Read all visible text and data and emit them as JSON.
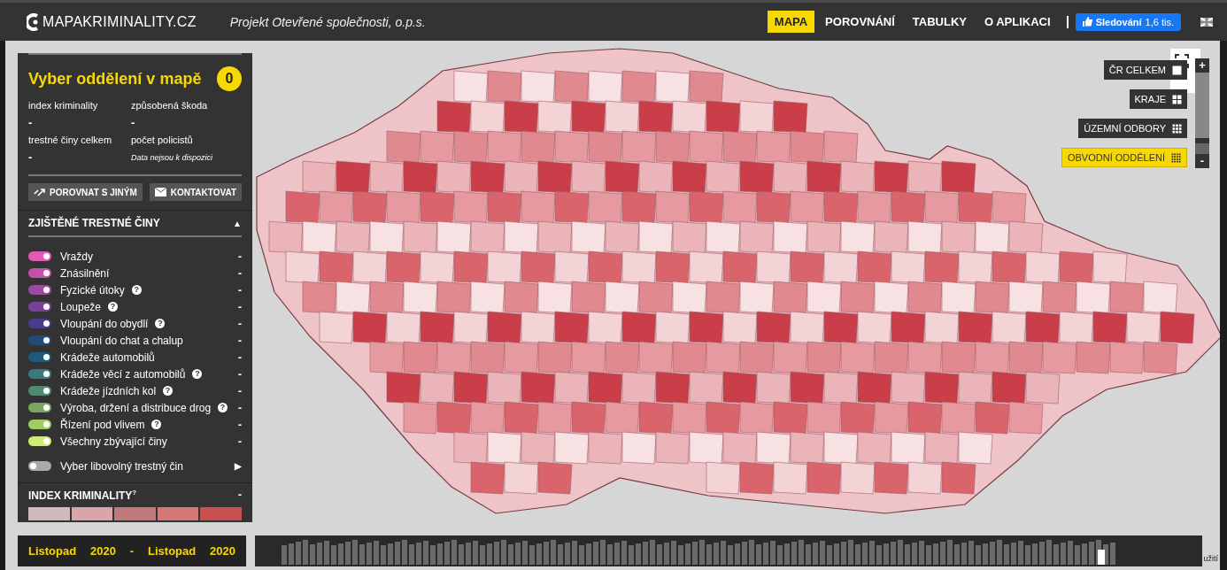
{
  "header": {
    "logo": "MAPAKRIMINALITY.CZ",
    "subtitle": "Projekt Otevřené společnosti, o.p.s.",
    "nav": [
      {
        "label": "MAPA",
        "selected": true
      },
      {
        "label": "POROVNÁNÍ",
        "selected": false
      },
      {
        "label": "TABULKY",
        "selected": false
      },
      {
        "label": "O APLIKACI",
        "selected": false
      }
    ],
    "follow_button": {
      "label": "Sledování",
      "count": "1,6 tis."
    }
  },
  "panel": {
    "title": "Vyber oddělení v mapě",
    "count": "0",
    "stats": [
      {
        "label": "index kriminality",
        "value": "-",
        "kind": "value"
      },
      {
        "label": "způsobená škoda",
        "value": "-",
        "kind": "value"
      },
      {
        "label": "trestné činy celkem",
        "value": "-",
        "kind": "value"
      },
      {
        "label": "počet policistů",
        "value": "Data nejsou k dispozici",
        "kind": "note"
      }
    ],
    "buttons": [
      {
        "label": "POROVNAT S JINÝM"
      },
      {
        "label": "KONTAKTOVAT"
      }
    ],
    "section": {
      "title": "ZJIŠTĚNÉ TRESTNÉ ČINY",
      "arrow": "▲"
    },
    "crimes": [
      {
        "label": "Vraždy",
        "color": "#e05bb5",
        "on": true,
        "value": "-"
      },
      {
        "label": "Znásilnění",
        "color": "#c451a8",
        "on": true,
        "value": "-"
      },
      {
        "label": "Fyzické útoky",
        "color": "#9c4aa0",
        "on": true,
        "help": "?",
        "value": "-"
      },
      {
        "label": "Loupeže",
        "color": "#7b3f9a",
        "on": true,
        "help": "?",
        "value": "-"
      },
      {
        "label": "Vloupání do obydlí",
        "color": "#4a3c8c",
        "on": true,
        "help": "?",
        "value": "-"
      },
      {
        "label": "Vloupání do chat a chalup",
        "color": "#1f4a7a",
        "on": true,
        "value": "-"
      },
      {
        "label": "Krádeže automobilů",
        "color": "#1f5a7a",
        "on": true,
        "value": "-"
      },
      {
        "label": "Krádeže věcí z automobilů",
        "color": "#3a7a7a",
        "on": true,
        "help": "?",
        "value": "-"
      },
      {
        "label": "Krádeže jízdních kol",
        "color": "#4f8a70",
        "on": true,
        "help": "?",
        "value": "-"
      },
      {
        "label": "Výroba, držení a distribuce drog",
        "color": "#78a860",
        "on": true,
        "help": "?",
        "value": "-"
      },
      {
        "label": "Řízení pod vlivem",
        "color": "#a0cc60",
        "on": true,
        "help": "?",
        "value": "-"
      },
      {
        "label": "Všechny zbývající činy",
        "color": "#d0ec70",
        "on": true,
        "value": "-"
      }
    ],
    "custom_crime": {
      "label": "Vyber libovolný trestný čin",
      "on": false,
      "arrow": "▶"
    },
    "index": {
      "title": "INDEX KRIMINALITY$^{?}$",
      "value": "-",
      "scale": [
        {
          "color": "#cfb9bb"
        },
        {
          "color": "#d8a5a8"
        },
        {
          "color": "#c07a7c"
        },
        {
          "color": "#d47578"
        },
        {
          "color": "#c9504f"
        }
      ]
    }
  },
  "map_layers": [
    {
      "label": "ČR CELKEM",
      "selected": false
    },
    {
      "label": "KRAJE",
      "selected": false
    },
    {
      "label": "ÚZEMNÍ ODBORY",
      "selected": false
    },
    {
      "label": "OBVODNÍ ODDĚLENÍ",
      "selected": true
    }
  ],
  "zoom": {
    "in": "+",
    "out": "-",
    "level": 0.2
  },
  "period": {
    "from_month": "Listopad",
    "from_year": "2020",
    "separator": "-",
    "to_month": "Listopad",
    "to_year": "2020"
  },
  "attribution": "užití"
}
